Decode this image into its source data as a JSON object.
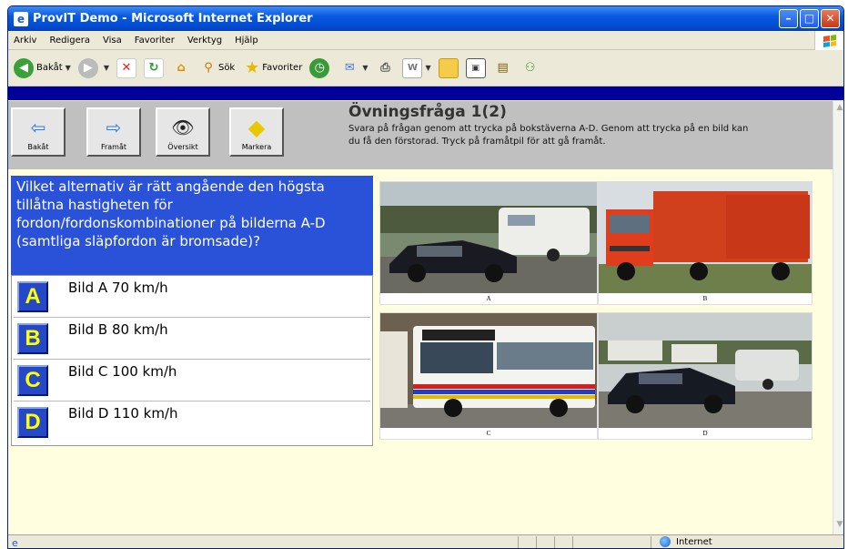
{
  "window": {
    "title": "ProvIT Demo - Microsoft Internet Explorer",
    "app_icon": "ie-icon"
  },
  "menu": [
    "Arkiv",
    "Redigera",
    "Visa",
    "Favoriter",
    "Verktyg",
    "Hjälp"
  ],
  "toolbar": {
    "back_label": "Bakåt",
    "search_label": "Sök",
    "favorites_label": "Favoriter"
  },
  "nav": {
    "back_label": "Bakåt",
    "forward_label": "Framåt",
    "overview_label": "Översikt",
    "mark_label": "Markera"
  },
  "header": {
    "title": "Övningsfråga 1(2)",
    "instructions": "Svara på frågan genom att trycka på bokstäverna A-D. Genom att trycka på en bild kan du få den förstorad. Tryck på framåtpil för att gå framåt."
  },
  "question": "Vilket alternativ är rätt angående den högsta tillåtna hastigheten för fordon/fordonskombinationer på bilderna A-D (samtliga släpfordon är bromsade)?",
  "answers": [
    {
      "key": "A",
      "text": "Bild A 70 km/h"
    },
    {
      "key": "B",
      "text": "Bild B 80 km/h"
    },
    {
      "key": "C",
      "text": "Bild C 100 km/h"
    },
    {
      "key": "D",
      "text": "Bild D 110 km/h"
    }
  ],
  "photos": [
    {
      "caption": "A",
      "subject": "car-with-caravan"
    },
    {
      "caption": "B",
      "subject": "truck-with-trailer"
    },
    {
      "caption": "C",
      "subject": "bus"
    },
    {
      "caption": "D",
      "subject": "car-with-small-trailer"
    }
  ],
  "status": {
    "zone": "Internet"
  },
  "colors": {
    "titlebar": "#0a5ae0",
    "navy_bar": "#000099",
    "question_bg": "#2a52d8",
    "key_text": "#ffff00",
    "page_bg": "#ffffe0"
  }
}
